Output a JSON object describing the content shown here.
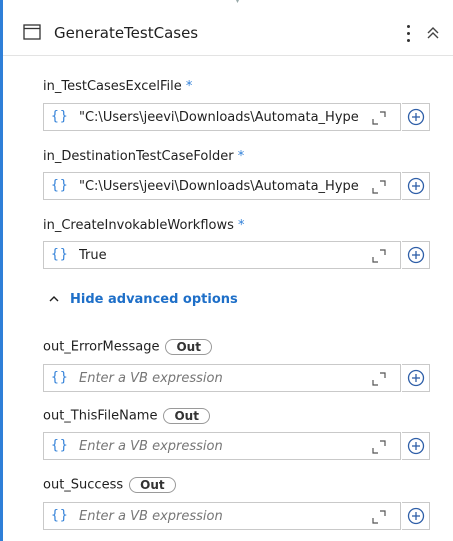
{
  "activity": {
    "title": "GenerateTestCases"
  },
  "arguments": [
    {
      "name": "in_TestCasesExcelFile",
      "required_mark": "*",
      "value": "\"C:\\Users\\jeevi\\Downloads\\Automata_Hype"
    },
    {
      "name": "in_DestinationTestCaseFolder",
      "required_mark": "*",
      "value": "\"C:\\Users\\jeevi\\Downloads\\Automata_Hype"
    },
    {
      "name": "in_CreateInvokableWorkflows",
      "required_mark": "*",
      "value": "True"
    }
  ],
  "advanced": {
    "toggle_label": "Hide advanced options"
  },
  "out_arguments": [
    {
      "name": "out_ErrorMessage",
      "direction": "Out",
      "placeholder": "Enter a VB expression"
    },
    {
      "name": "out_ThisFileName",
      "direction": "Out",
      "placeholder": "Enter a VB expression"
    },
    {
      "name": "out_Success",
      "direction": "Out",
      "placeholder": "Enter a VB expression"
    }
  ],
  "field_braces": "{}",
  "colors": {
    "accent": "#2f7fd8",
    "link": "#1e6fc8",
    "border": "#c9c9c9",
    "placeholder": "#767676"
  },
  "icons": {
    "activity": "window-icon",
    "menu": "kebab-menu-icon",
    "collapse": "chevron-double-up-icon",
    "expand": "expand-editor-icon",
    "add": "plus-circle-icon",
    "toggle": "chevron-up-icon"
  }
}
